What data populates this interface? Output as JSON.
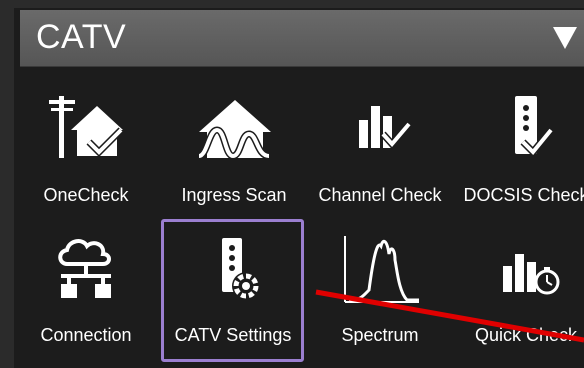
{
  "header": {
    "title": "CATV"
  },
  "tiles": [
    {
      "label": "OneCheck",
      "icon": "onecheck-icon"
    },
    {
      "label": "Ingress Scan",
      "icon": "ingress-scan-icon"
    },
    {
      "label": "Channel Check",
      "icon": "channel-check-icon"
    },
    {
      "label": "DOCSIS Check",
      "icon": "docsis-check-icon"
    },
    {
      "label": "Connection",
      "icon": "connection-icon"
    },
    {
      "label": "CATV Settings",
      "icon": "catv-settings-icon"
    },
    {
      "label": "Spectrum",
      "icon": "spectrum-icon"
    },
    {
      "label": "Quick Check",
      "icon": "quick-check-icon"
    }
  ],
  "colors": {
    "header": "#5e5e5e",
    "background": "#1c1c1c",
    "selection": "#9b7fd0",
    "annotation": "#e00000"
  }
}
